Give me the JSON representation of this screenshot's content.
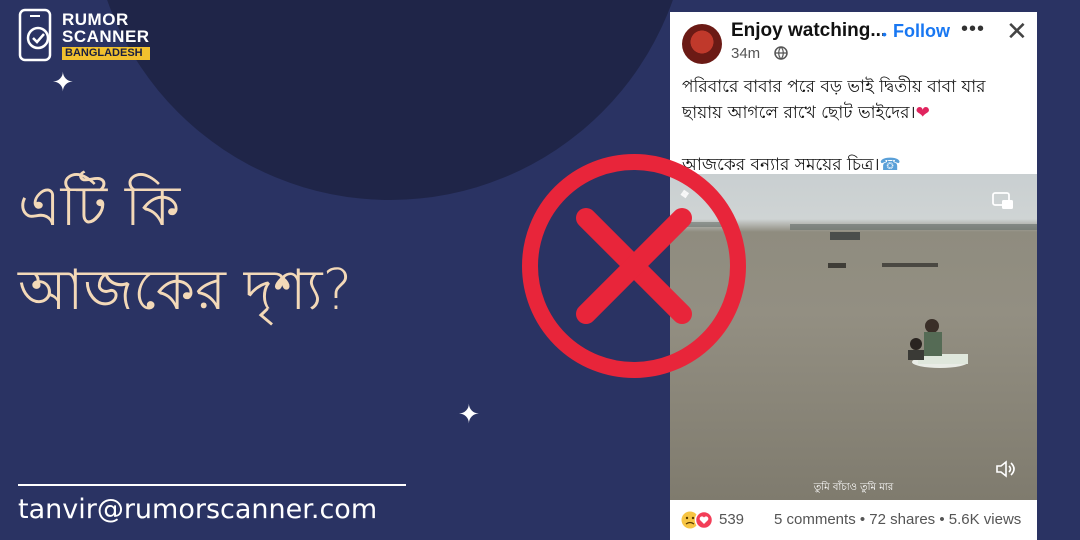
{
  "logo": {
    "line1": "RUMOR",
    "line2": "SCANNER",
    "badge": "BANGLADESH"
  },
  "headline": {
    "line1": "এটি কি",
    "line2": "আজকের দৃশ্য?"
  },
  "contact": {
    "email": "tanvir@rumorscanner.com"
  },
  "post": {
    "poster_name": "Enjoy watching...",
    "follow_label": "Follow",
    "time": "34m",
    "text_line1": "পরিবারে বাবার পরে বড় ভাই দ্বিতীয় বাবা যার",
    "text_line2": "ছায়ায় আগলে রাখে ছোট ভাইদের।",
    "text_line3": "আজকের বন্যার সময়ের চিত্র।",
    "video_caption": "তুমি বাঁচাও তুমি মার",
    "reaction_count": "539",
    "stats": "5 comments • 72 shares • 5.6K views"
  },
  "colors": {
    "background": "#2a3363",
    "accent_red": "#e8253a",
    "headline": "#f3d9b8",
    "link_blue": "#1877f2",
    "badge": "#f2c12e"
  },
  "icons": [
    "phone-check-icon",
    "sparkle-icon",
    "x-mark-icon",
    "more-icon",
    "close-icon",
    "globe-icon",
    "heart-icon",
    "pip-icon",
    "speaker-icon",
    "reactions-icon"
  ]
}
